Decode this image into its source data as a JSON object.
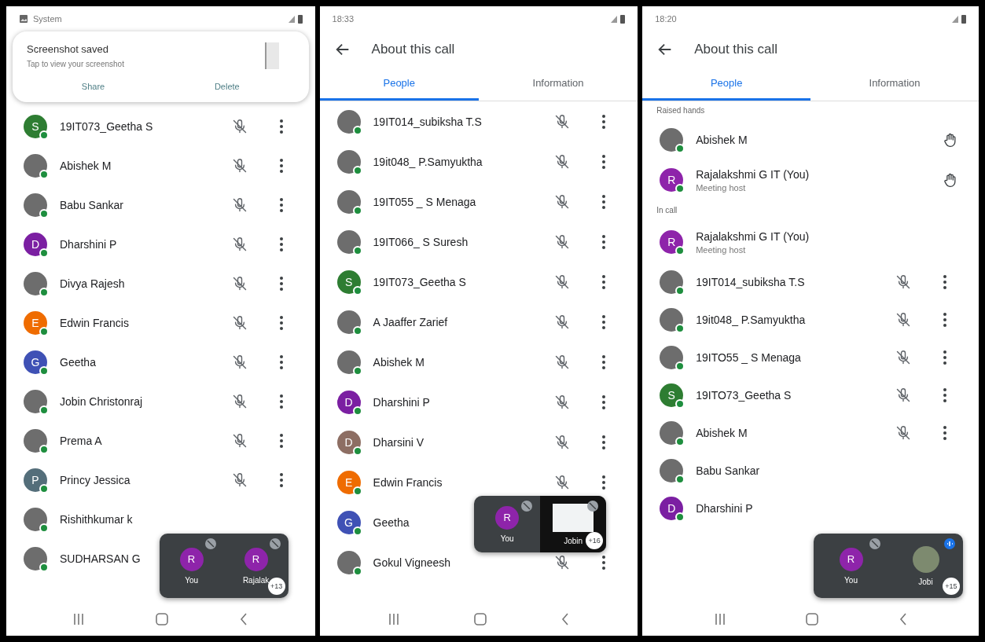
{
  "phones": [
    {
      "status_bar": {
        "label": "System"
      },
      "notification": {
        "title": "Screenshot saved",
        "subtitle": "Tap to view your screenshot",
        "actions": [
          "Share",
          "Delete"
        ]
      },
      "sections": [
        {
          "rows": [
            {
              "name": "19IT073_Geetha S",
              "avatar": {
                "kind": "initial",
                "letter": "S",
                "color": "#2e7d32"
              },
              "kind": "mute"
            },
            {
              "name": "Abishek M",
              "avatar": {
                "kind": "photo"
              },
              "kind": "mute"
            },
            {
              "name": "Babu Sankar",
              "avatar": {
                "kind": "photo"
              },
              "kind": "mute"
            },
            {
              "name": "Dharshini P",
              "avatar": {
                "kind": "initial",
                "letter": "D",
                "color": "#7b1fa2"
              },
              "kind": "mute"
            },
            {
              "name": "Divya Rajesh",
              "avatar": {
                "kind": "photo"
              },
              "kind": "mute"
            },
            {
              "name": "Edwin Francis",
              "avatar": {
                "kind": "initial",
                "letter": "E",
                "color": "#ef6c00"
              },
              "kind": "mute"
            },
            {
              "name": "Geetha",
              "avatar": {
                "kind": "initial",
                "letter": "G",
                "color": "#3f51b5"
              },
              "kind": "mute"
            },
            {
              "name": "Jobin Christonraj",
              "avatar": {
                "kind": "photo"
              },
              "kind": "mute"
            },
            {
              "name": "Prema A",
              "avatar": {
                "kind": "photo"
              },
              "kind": "mute"
            },
            {
              "name": "Princy Jessica",
              "avatar": {
                "kind": "initial",
                "letter": "P",
                "color": "#546e7a"
              },
              "kind": "mute"
            },
            {
              "name": "Rishithkumar k",
              "avatar": {
                "kind": "photo"
              },
              "kind": "plain"
            },
            {
              "name": "SUDHARSAN G",
              "avatar": {
                "kind": "photo"
              },
              "kind": "plain"
            }
          ]
        }
      ],
      "pip": {
        "tiles": [
          {
            "kind": "avatar",
            "letter": "R",
            "label": "You",
            "speaking": false
          },
          {
            "kind": "avatar",
            "letter": "R",
            "label": "Rajalak",
            "speaking": false
          }
        ],
        "more": "+13"
      }
    },
    {
      "status_bar": {
        "time": "18:33"
      },
      "app_bar": {
        "title": "About this call"
      },
      "tabs": [
        {
          "label": "People",
          "selected": true
        },
        {
          "label": "Information",
          "selected": false
        }
      ],
      "sections": [
        {
          "rows": [
            {
              "name": "19IT014_subiksha T.S",
              "avatar": {
                "kind": "photo"
              },
              "kind": "mute"
            },
            {
              "name": "19it048_ P.Samyuktha",
              "avatar": {
                "kind": "photo"
              },
              "kind": "mute"
            },
            {
              "name": "19IT055 _ S Menaga",
              "avatar": {
                "kind": "photo"
              },
              "kind": "mute"
            },
            {
              "name": "19IT066_ S Suresh",
              "avatar": {
                "kind": "photo"
              },
              "kind": "mute"
            },
            {
              "name": "19IT073_Geetha S",
              "avatar": {
                "kind": "initial",
                "letter": "S",
                "color": "#2e7d32"
              },
              "kind": "mute"
            },
            {
              "name": "A Jaaffer Zarief",
              "avatar": {
                "kind": "photo"
              },
              "kind": "mute"
            },
            {
              "name": "Abishek M",
              "avatar": {
                "kind": "photo"
              },
              "kind": "mute"
            },
            {
              "name": "Dharshini P",
              "avatar": {
                "kind": "initial",
                "letter": "D",
                "color": "#7b1fa2"
              },
              "kind": "mute"
            },
            {
              "name": "Dharsini V",
              "avatar": {
                "kind": "initial",
                "letter": "D",
                "color": "#8d6e63"
              },
              "kind": "mute"
            },
            {
              "name": "Edwin Francis",
              "avatar": {
                "kind": "initial",
                "letter": "E",
                "color": "#ef6c00"
              },
              "kind": "mute"
            },
            {
              "name": "Geetha",
              "avatar": {
                "kind": "initial",
                "letter": "G",
                "color": "#3f51b5"
              },
              "kind": "plain"
            },
            {
              "name": "Gokul Vigneesh",
              "avatar": {
                "kind": "photo"
              },
              "kind": "mute"
            }
          ]
        }
      ],
      "pip": {
        "tiles": [
          {
            "kind": "avatar",
            "letter": "R",
            "label": "You",
            "speaking": false
          },
          {
            "kind": "screen",
            "label": "Jobin",
            "speaking": false
          }
        ],
        "more": "+16"
      }
    },
    {
      "status_bar": {
        "time": "18:20"
      },
      "app_bar": {
        "title": "About this call"
      },
      "tabs": [
        {
          "label": "People",
          "selected": true
        },
        {
          "label": "Information",
          "selected": false
        }
      ],
      "sections": [
        {
          "heading": "Raised hands",
          "rows": [
            {
              "name": "Abishek M",
              "avatar": {
                "kind": "photo"
              },
              "kind": "hand"
            },
            {
              "name": "Rajalakshmi G IT (You)",
              "subtitle": "Meeting host",
              "avatar": {
                "kind": "initial",
                "letter": "R",
                "color": "#8e24aa"
              },
              "kind": "hand"
            }
          ]
        },
        {
          "heading": "In call",
          "rows": [
            {
              "name": "Rajalakshmi G IT (You)",
              "subtitle": "Meeting host",
              "avatar": {
                "kind": "initial",
                "letter": "R",
                "color": "#8e24aa"
              },
              "kind": "plain"
            },
            {
              "name": "19IT014_subiksha T.S",
              "avatar": {
                "kind": "photo"
              },
              "kind": "mute"
            },
            {
              "name": "19it048_ P.Samyuktha",
              "avatar": {
                "kind": "photo"
              },
              "kind": "mute"
            },
            {
              "name": "19ITO55 _ S Menaga",
              "avatar": {
                "kind": "photo"
              },
              "kind": "mute"
            },
            {
              "name": "19ITO73_Geetha S",
              "avatar": {
                "kind": "initial",
                "letter": "S",
                "color": "#2e7d32"
              },
              "kind": "mute"
            },
            {
              "name": "Abishek M",
              "avatar": {
                "kind": "photo"
              },
              "kind": "mute"
            },
            {
              "name": "Babu Sankar",
              "avatar": {
                "kind": "photo"
              },
              "kind": "plain"
            },
            {
              "name": "Dharshini P",
              "avatar": {
                "kind": "initial",
                "letter": "D",
                "color": "#7b1fa2"
              },
              "kind": "plain"
            }
          ]
        }
      ],
      "pip": {
        "tiles": [
          {
            "kind": "avatar",
            "letter": "R",
            "label": "You",
            "speaking": false
          },
          {
            "kind": "photo",
            "label": "Jobi",
            "speaking": true
          }
        ],
        "more": "+15"
      }
    }
  ]
}
